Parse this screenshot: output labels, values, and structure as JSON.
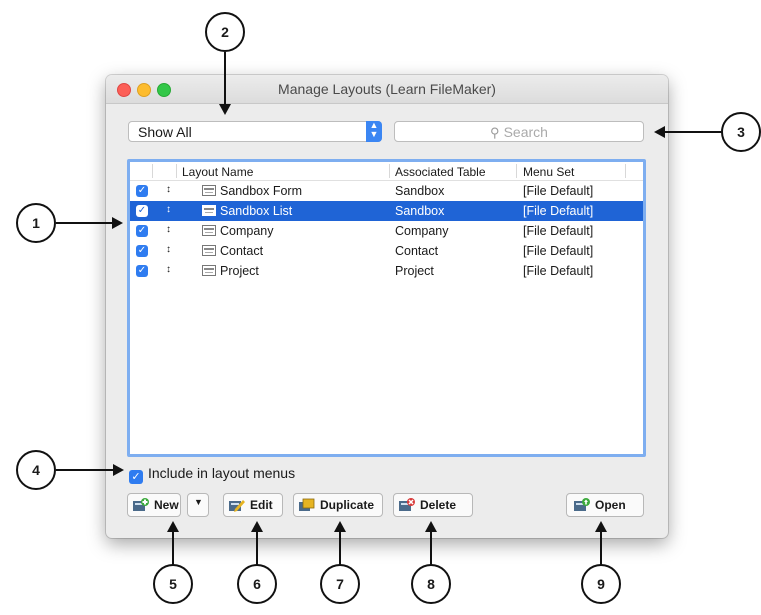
{
  "window": {
    "title": "Manage Layouts (Learn FileMaker)"
  },
  "filter": {
    "selected": "Show All"
  },
  "search": {
    "placeholder": "Search"
  },
  "table": {
    "headers": [
      "Layout Name",
      "Associated Table",
      "Menu Set"
    ],
    "rows": [
      {
        "name": "Sandbox Form",
        "table": "Sandbox",
        "menu": "[File Default]",
        "checked": true,
        "selected": false
      },
      {
        "name": "Sandbox List",
        "table": "Sandbox",
        "menu": "[File Default]",
        "checked": true,
        "selected": true
      },
      {
        "name": "Company",
        "table": "Company",
        "menu": "[File Default]",
        "checked": true,
        "selected": false
      },
      {
        "name": "Contact",
        "table": "Contact",
        "menu": "[File Default]",
        "checked": true,
        "selected": false
      },
      {
        "name": "Project",
        "table": "Project",
        "menu": "[File Default]",
        "checked": true,
        "selected": false
      }
    ]
  },
  "include": {
    "label": "Include in layout menus",
    "checked": true
  },
  "buttons": {
    "new": "New",
    "edit": "Edit",
    "duplicate": "Duplicate",
    "delete": "Delete",
    "open": "Open"
  },
  "callouts": [
    "1",
    "2",
    "3",
    "4",
    "5",
    "6",
    "7",
    "8",
    "9"
  ],
  "colors": {
    "accent": "#1f64d6",
    "checkbox": "#2f7cf0",
    "list_border": "#7eaef0"
  }
}
